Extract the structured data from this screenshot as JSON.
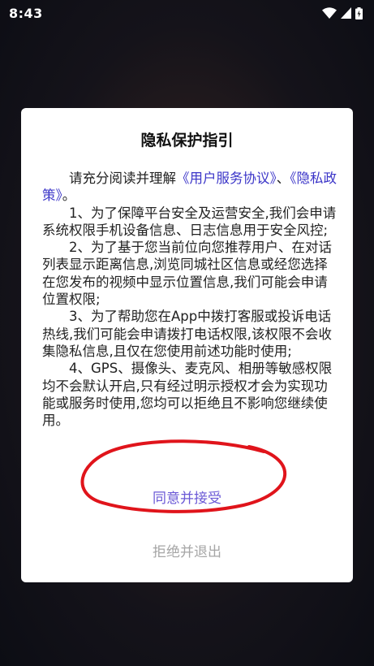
{
  "status_bar": {
    "time": "8:43",
    "icons": [
      "wifi-icon",
      "signal-icon",
      "battery-charging-icon"
    ]
  },
  "dialog": {
    "title": "隐私保护指引",
    "intro_prefix": "请充分阅读并理解",
    "link_user_agreement": "《用户服务协议》",
    "intro_sep": "、",
    "link_privacy_policy": "《隐私政策》",
    "intro_suffix": "。",
    "items": [
      "1、为了保障平台安全及运营安全,我们会申请系统权限手机设备信息、日志信息用于安全风控;",
      "2、为了基于您当前位向您推荐用户、在对话列表显示距离信息,浏览同城社区信息或经您选择在您发布的视频中显示位置信息,我们可能会申请位置权限;",
      "3、为了帮助您在App中拨打客服或投诉电话热线,我们可能会申请拨打电话权限,该权限不会收集隐私信息,且仅在您使用前述功能时使用;",
      "4、GPS、摄像头、麦克风、相册等敏感权限均不会默认开启,只有经过明示授权才会为实现功能或服务时使用,您均可以拒绝且不影响您继续使用。"
    ],
    "accept_label": "同意并接受",
    "reject_label": "拒绝并退出"
  },
  "colors": {
    "link": "#3b35c8",
    "accept": "#6a58d6",
    "reject": "#a6a6a6",
    "annotation": "#e0141b"
  }
}
